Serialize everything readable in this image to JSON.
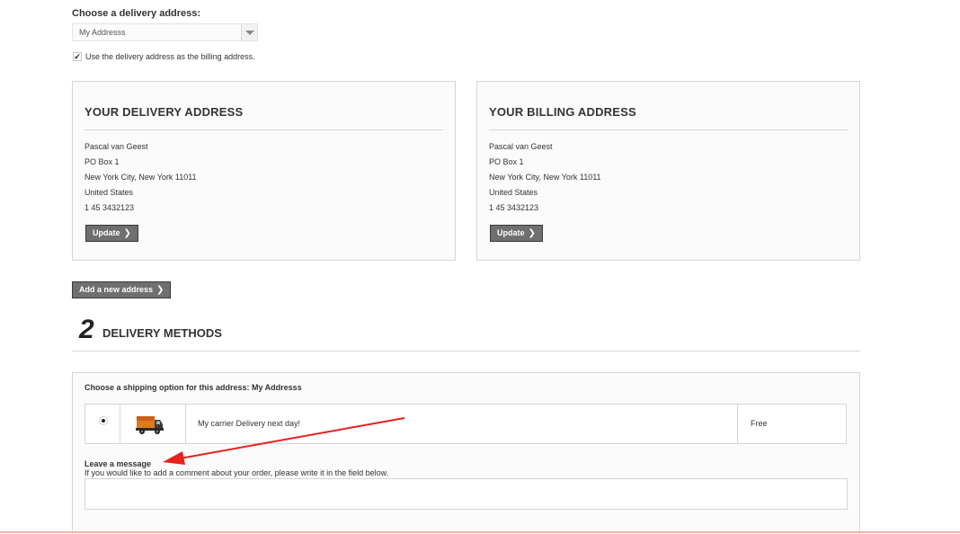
{
  "address_select": {
    "label": "Choose a delivery address:",
    "selected": "My Addresss"
  },
  "billing_checkbox": {
    "checked_glyph": "✔",
    "label": "Use the delivery address as the billing address."
  },
  "delivery_address": {
    "title": "YOUR DELIVERY ADDRESS",
    "lines": [
      "Pascal van Geest",
      "PO Box 1",
      "New York City, New York 11011",
      "United States",
      "1 45 3432123"
    ],
    "update_label": "Update"
  },
  "billing_address": {
    "title": "YOUR BILLING ADDRESS",
    "lines": [
      "Pascal van Geest",
      "PO Box 1",
      "New York City, New York 11011",
      "United States",
      "1 45 3432123"
    ],
    "update_label": "Update"
  },
  "add_address_label": "Add a new address",
  "chevron": "❯",
  "step": {
    "number": "2",
    "title": "DELIVERY METHODS"
  },
  "shipping": {
    "heading": "Choose a shipping option for this address: My Addresss",
    "carrier": "My carrier Delivery next day!",
    "price": "Free"
  },
  "message": {
    "title": "Leave a message",
    "subtitle": "If you would like to add a comment about your order, please write it in the field below."
  },
  "colors": {
    "annotation_arrow": "#e8201e",
    "button_bg": "#6f6f6f",
    "border": "#d6d4d4"
  }
}
